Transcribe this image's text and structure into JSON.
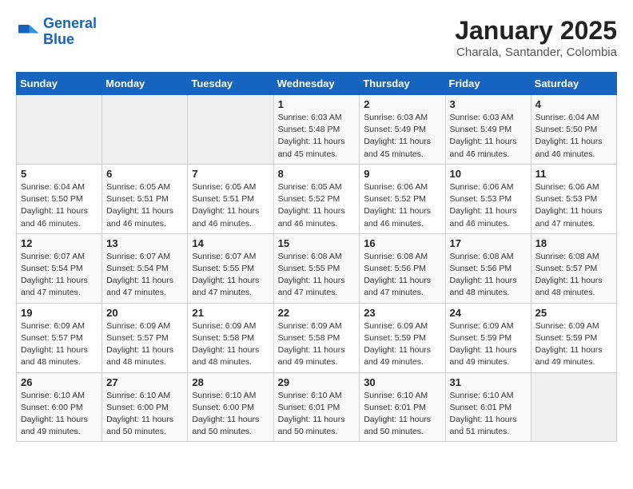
{
  "header": {
    "logo_line1": "General",
    "logo_line2": "Blue",
    "month_year": "January 2025",
    "location": "Charala, Santander, Colombia"
  },
  "weekdays": [
    "Sunday",
    "Monday",
    "Tuesday",
    "Wednesday",
    "Thursday",
    "Friday",
    "Saturday"
  ],
  "weeks": [
    [
      {
        "day": "",
        "info": ""
      },
      {
        "day": "",
        "info": ""
      },
      {
        "day": "",
        "info": ""
      },
      {
        "day": "1",
        "info": "Sunrise: 6:03 AM\nSunset: 5:48 PM\nDaylight: 11 hours and 45 minutes."
      },
      {
        "day": "2",
        "info": "Sunrise: 6:03 AM\nSunset: 5:49 PM\nDaylight: 11 hours and 45 minutes."
      },
      {
        "day": "3",
        "info": "Sunrise: 6:03 AM\nSunset: 5:49 PM\nDaylight: 11 hours and 46 minutes."
      },
      {
        "day": "4",
        "info": "Sunrise: 6:04 AM\nSunset: 5:50 PM\nDaylight: 11 hours and 46 minutes."
      }
    ],
    [
      {
        "day": "5",
        "info": "Sunrise: 6:04 AM\nSunset: 5:50 PM\nDaylight: 11 hours and 46 minutes."
      },
      {
        "day": "6",
        "info": "Sunrise: 6:05 AM\nSunset: 5:51 PM\nDaylight: 11 hours and 46 minutes."
      },
      {
        "day": "7",
        "info": "Sunrise: 6:05 AM\nSunset: 5:51 PM\nDaylight: 11 hours and 46 minutes."
      },
      {
        "day": "8",
        "info": "Sunrise: 6:05 AM\nSunset: 5:52 PM\nDaylight: 11 hours and 46 minutes."
      },
      {
        "day": "9",
        "info": "Sunrise: 6:06 AM\nSunset: 5:52 PM\nDaylight: 11 hours and 46 minutes."
      },
      {
        "day": "10",
        "info": "Sunrise: 6:06 AM\nSunset: 5:53 PM\nDaylight: 11 hours and 46 minutes."
      },
      {
        "day": "11",
        "info": "Sunrise: 6:06 AM\nSunset: 5:53 PM\nDaylight: 11 hours and 47 minutes."
      }
    ],
    [
      {
        "day": "12",
        "info": "Sunrise: 6:07 AM\nSunset: 5:54 PM\nDaylight: 11 hours and 47 minutes."
      },
      {
        "day": "13",
        "info": "Sunrise: 6:07 AM\nSunset: 5:54 PM\nDaylight: 11 hours and 47 minutes."
      },
      {
        "day": "14",
        "info": "Sunrise: 6:07 AM\nSunset: 5:55 PM\nDaylight: 11 hours and 47 minutes."
      },
      {
        "day": "15",
        "info": "Sunrise: 6:08 AM\nSunset: 5:55 PM\nDaylight: 11 hours and 47 minutes."
      },
      {
        "day": "16",
        "info": "Sunrise: 6:08 AM\nSunset: 5:56 PM\nDaylight: 11 hours and 47 minutes."
      },
      {
        "day": "17",
        "info": "Sunrise: 6:08 AM\nSunset: 5:56 PM\nDaylight: 11 hours and 48 minutes."
      },
      {
        "day": "18",
        "info": "Sunrise: 6:08 AM\nSunset: 5:57 PM\nDaylight: 11 hours and 48 minutes."
      }
    ],
    [
      {
        "day": "19",
        "info": "Sunrise: 6:09 AM\nSunset: 5:57 PM\nDaylight: 11 hours and 48 minutes."
      },
      {
        "day": "20",
        "info": "Sunrise: 6:09 AM\nSunset: 5:57 PM\nDaylight: 11 hours and 48 minutes."
      },
      {
        "day": "21",
        "info": "Sunrise: 6:09 AM\nSunset: 5:58 PM\nDaylight: 11 hours and 48 minutes."
      },
      {
        "day": "22",
        "info": "Sunrise: 6:09 AM\nSunset: 5:58 PM\nDaylight: 11 hours and 49 minutes."
      },
      {
        "day": "23",
        "info": "Sunrise: 6:09 AM\nSunset: 5:59 PM\nDaylight: 11 hours and 49 minutes."
      },
      {
        "day": "24",
        "info": "Sunrise: 6:09 AM\nSunset: 5:59 PM\nDaylight: 11 hours and 49 minutes."
      },
      {
        "day": "25",
        "info": "Sunrise: 6:09 AM\nSunset: 5:59 PM\nDaylight: 11 hours and 49 minutes."
      }
    ],
    [
      {
        "day": "26",
        "info": "Sunrise: 6:10 AM\nSunset: 6:00 PM\nDaylight: 11 hours and 49 minutes."
      },
      {
        "day": "27",
        "info": "Sunrise: 6:10 AM\nSunset: 6:00 PM\nDaylight: 11 hours and 50 minutes."
      },
      {
        "day": "28",
        "info": "Sunrise: 6:10 AM\nSunset: 6:00 PM\nDaylight: 11 hours and 50 minutes."
      },
      {
        "day": "29",
        "info": "Sunrise: 6:10 AM\nSunset: 6:01 PM\nDaylight: 11 hours and 50 minutes."
      },
      {
        "day": "30",
        "info": "Sunrise: 6:10 AM\nSunset: 6:01 PM\nDaylight: 11 hours and 50 minutes."
      },
      {
        "day": "31",
        "info": "Sunrise: 6:10 AM\nSunset: 6:01 PM\nDaylight: 11 hours and 51 minutes."
      },
      {
        "day": "",
        "info": ""
      }
    ]
  ]
}
